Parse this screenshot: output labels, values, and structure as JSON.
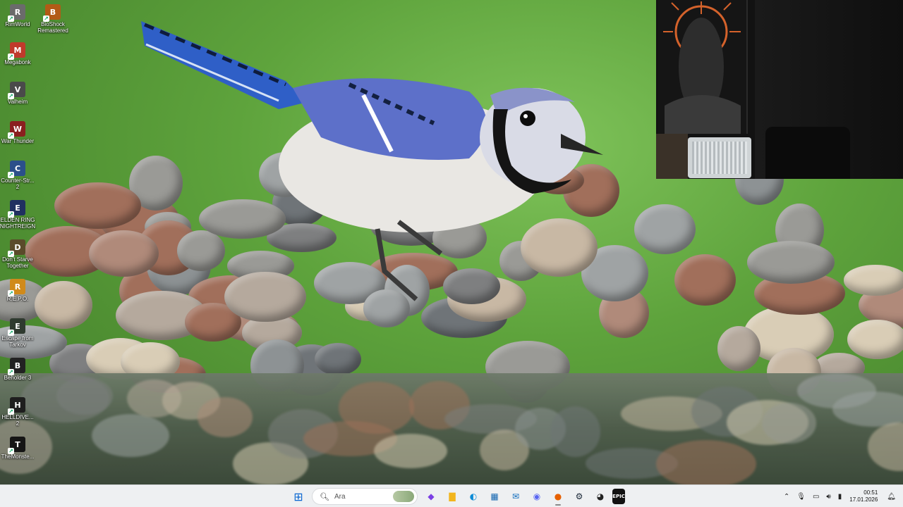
{
  "desktop": {
    "icons": [
      {
        "label": "RimWorld",
        "icon": "rimworld-icon",
        "color": "#6b6b6b"
      },
      {
        "label": "BioShock\nRemastered",
        "icon": "bioshock-icon",
        "color": "#b25b16"
      },
      {
        "label": "Megabonk",
        "icon": "megabonk-icon",
        "color": "#c0392b"
      },
      {
        "label": "Valheim",
        "icon": "valheim-icon",
        "color": "#4a4a4a"
      },
      {
        "label": "War Thunder",
        "icon": "warthunder-icon",
        "color": "#8a1f1f"
      },
      {
        "label": "Counter-Str...\n2",
        "icon": "cs2-icon",
        "color": "#2b4f8a"
      },
      {
        "label": "ELDEN RING\nNIGHTREIGN",
        "icon": "eldenring-icon",
        "color": "#203060"
      },
      {
        "label": "Don't Starve\nTogether",
        "icon": "dontstarve-icon",
        "color": "#5a4a2a"
      },
      {
        "label": "R.E.P.O.",
        "icon": "repo-icon",
        "color": "#d08a1a"
      },
      {
        "label": "Escape from\nTarkov",
        "icon": "tarkov-icon",
        "color": "#2f3a2f"
      },
      {
        "label": "Beholder 3",
        "icon": "beholder-icon",
        "color": "#222222"
      },
      {
        "label": "HELLDIVE...\n2",
        "icon": "helldivers-icon",
        "color": "#1e1e1e"
      },
      {
        "label": "TheMonste...",
        "icon": "monster-icon",
        "color": "#151515"
      }
    ]
  },
  "taskbar": {
    "search_placeholder": "Ara",
    "apps": [
      {
        "name": "windows-start",
        "glyph": "⊞",
        "color": "#0a66d1"
      },
      {
        "name": "copilot",
        "glyph": "◆",
        "color": "#7b3fe4"
      },
      {
        "name": "file-explorer",
        "glyph": "▇",
        "color": "#f2b51d"
      },
      {
        "name": "edge",
        "glyph": "◐",
        "color": "#0c8bd6"
      },
      {
        "name": "microsoft-store",
        "glyph": "▦",
        "color": "#1466b0"
      },
      {
        "name": "outlook",
        "glyph": "✉",
        "color": "#0f6cbd"
      },
      {
        "name": "discord",
        "glyph": "◉",
        "color": "#5865f2"
      },
      {
        "name": "firefox",
        "glyph": "●",
        "color": "#e66000"
      },
      {
        "name": "steam",
        "glyph": "⚙",
        "color": "#1b2838"
      },
      {
        "name": "steam-notify",
        "glyph": "◕",
        "color": "#222222"
      },
      {
        "name": "epic-games",
        "glyph": "EPIC",
        "color": "#111111"
      }
    ],
    "tray": {
      "icons": [
        "chevron-up-icon",
        "microphone-icon",
        "network-icon",
        "volume-icon",
        "battery-icon"
      ],
      "time": "00:51",
      "date": "17.01.2026"
    }
  },
  "colors": {
    "taskbar_bg": "#eef0f2",
    "accent": "#0a66d1"
  }
}
